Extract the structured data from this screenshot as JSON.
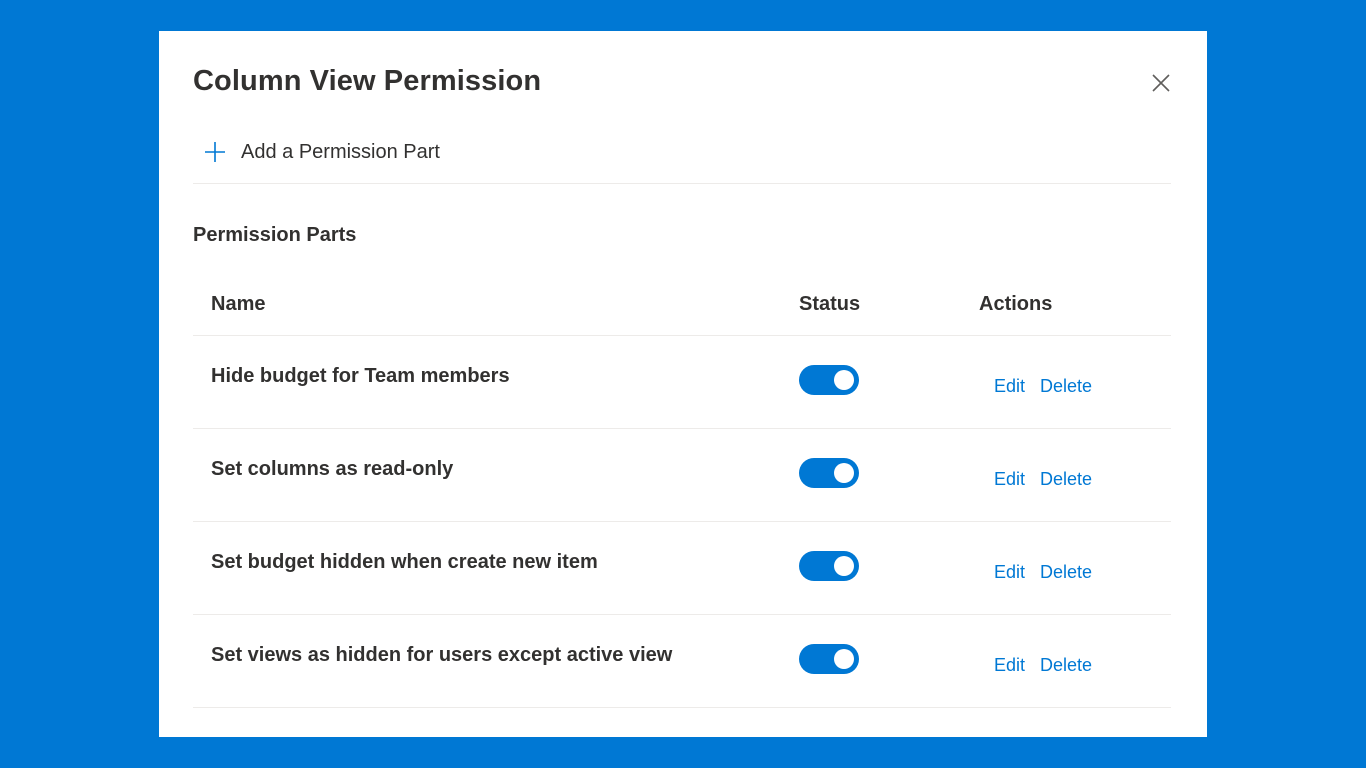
{
  "dialog": {
    "title": "Column View Permission",
    "close_icon": "close-icon",
    "add_button_label": "Add a Permission Part",
    "add_icon": "plus-icon",
    "section_title": "Permission Parts"
  },
  "table": {
    "columns": [
      "Name",
      "Status",
      "Actions"
    ],
    "rows": [
      {
        "name": "Hide budget for Team members",
        "status_on": true,
        "edit_label": "Edit",
        "delete_label": "Delete"
      },
      {
        "name": "Set columns as read-only",
        "status_on": true,
        "edit_label": "Edit",
        "delete_label": "Delete"
      },
      {
        "name": "Set budget hidden when create new item",
        "status_on": true,
        "edit_label": "Edit",
        "delete_label": "Delete"
      },
      {
        "name": "Set views as hidden for users except active view",
        "status_on": true,
        "edit_label": "Edit",
        "delete_label": "Delete"
      }
    ]
  },
  "colors": {
    "background": "#0078d4",
    "accent": "#0078d4",
    "text": "#323130",
    "divider": "#edebe9"
  }
}
